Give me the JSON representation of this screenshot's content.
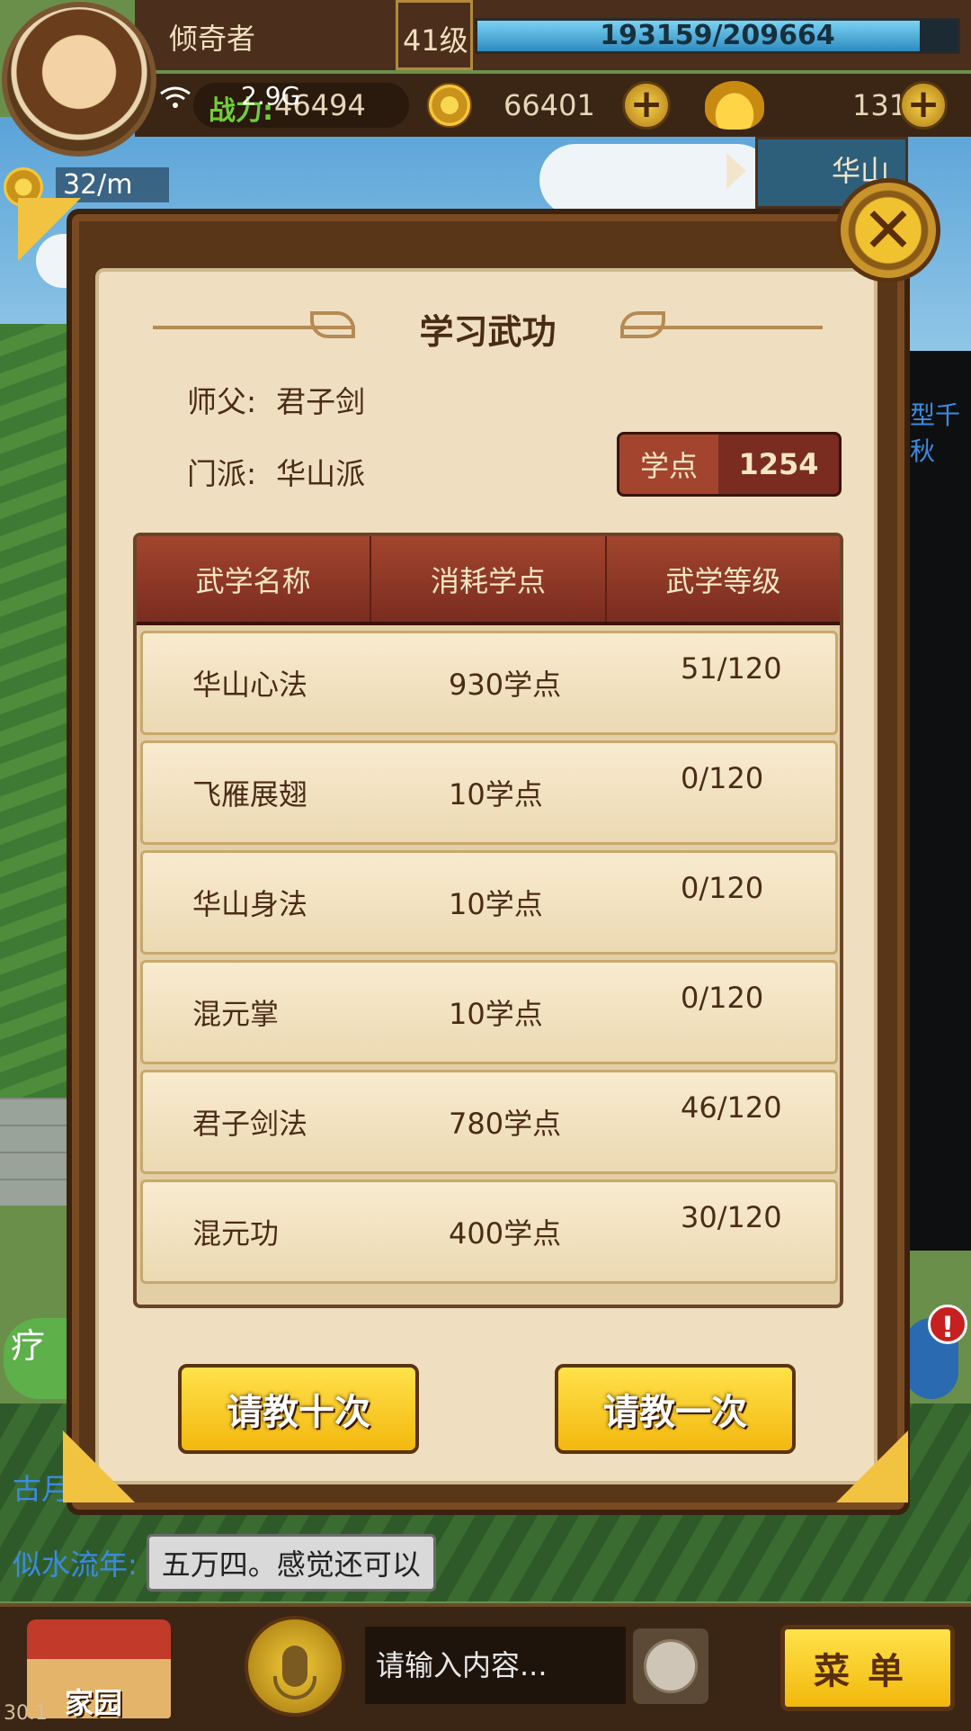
{
  "hud": {
    "player_name": "倾奇者",
    "level": "41级",
    "xp_text": "193159/209664",
    "xp_fraction": 0.921,
    "network": "2.9G",
    "power_label": "战力:",
    "power_value": "46494",
    "gold": "66401",
    "ingot": "131",
    "coin_rate": "32/m",
    "map_label": "华山",
    "plus_symbol": "+"
  },
  "background": {
    "side_link": "型千秋",
    "chat_prev": "古月",
    "chat_speaker": "似水流年:",
    "chat_message": "五万四。感觉还可以",
    "side_badge_text": "疗",
    "alert_symbol": "!"
  },
  "modal": {
    "title": "学习武功",
    "master_key": "师父:",
    "master_value": "君子剑",
    "sect_key": "门派:",
    "sect_value": "华山派",
    "points_label": "学点",
    "points_value": "1254",
    "close_symbol": "✕",
    "columns": [
      "武学名称",
      "消耗学点",
      "武学等级"
    ],
    "rows": [
      {
        "name": "华山心法",
        "cost": "930学点",
        "level": "51/120"
      },
      {
        "name": "飞雁展翅",
        "cost": "10学点",
        "level": "0/120"
      },
      {
        "name": "华山身法",
        "cost": "10学点",
        "level": "0/120"
      },
      {
        "name": "混元掌",
        "cost": "10学点",
        "level": "0/120"
      },
      {
        "name": "君子剑法",
        "cost": "780学点",
        "level": "46/120"
      },
      {
        "name": "混元功",
        "cost": "400学点",
        "level": "30/120"
      }
    ],
    "btn_ten": "请教十次",
    "btn_once": "请教一次"
  },
  "bottom": {
    "home_label": "家园",
    "input_placeholder": "请输入内容...",
    "menu_label": "菜单",
    "version": "30.1"
  },
  "icons": {
    "avatar": "player-avatar",
    "wifi": "wifi-icon",
    "coin": "coin-icon",
    "ingot": "ingot-icon",
    "close": "close-icon",
    "mic": "microphone-icon",
    "emoji": "emoji-icon",
    "home": "home-building-icon"
  },
  "colors": {
    "frame_brown": "#5a3618",
    "parchment": "#efdfc0",
    "header_red": "#a3452e",
    "button_yellow": "#f3b80e",
    "xp_blue": "#2e8bbf",
    "power_green": "#6fce3a"
  }
}
